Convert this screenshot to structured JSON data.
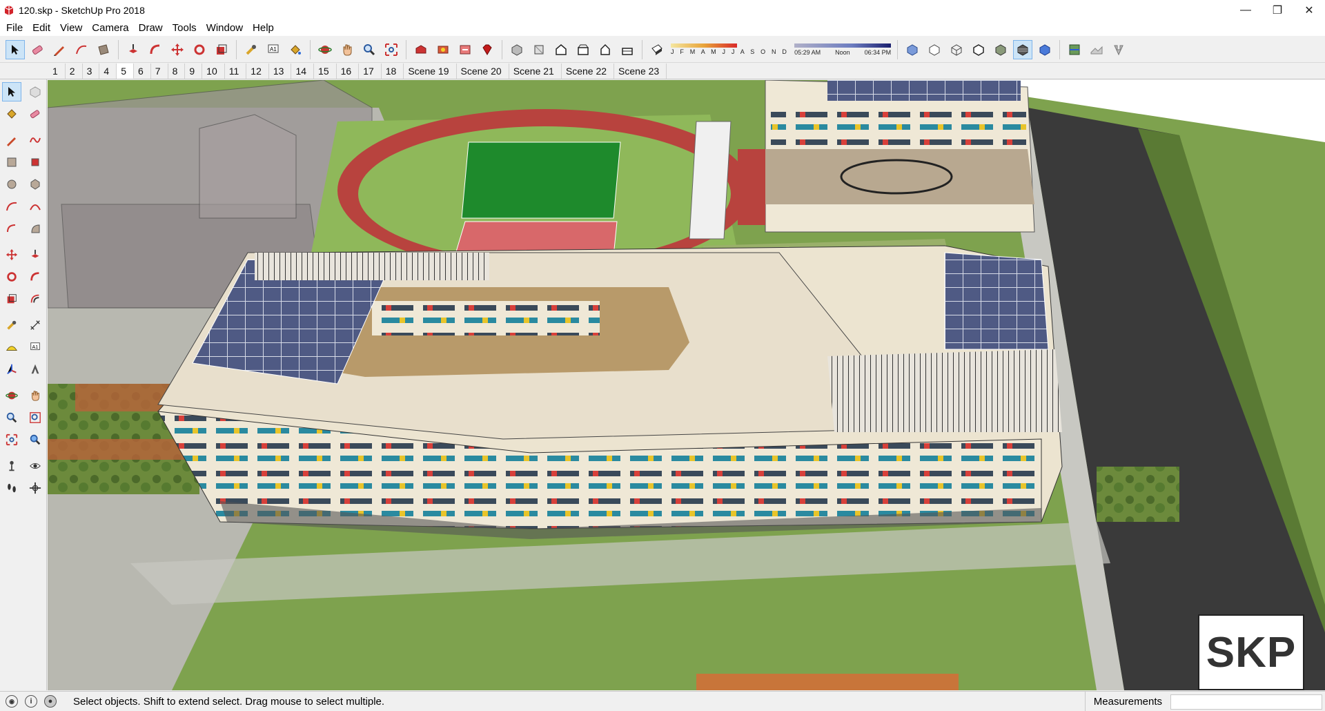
{
  "window": {
    "title": "120.skp - SketchUp Pro 2018",
    "controls": {
      "minimize": "—",
      "maximize": "❐",
      "close": "✕"
    }
  },
  "menu": {
    "items": [
      "File",
      "Edit",
      "View",
      "Camera",
      "Draw",
      "Tools",
      "Window",
      "Help"
    ]
  },
  "toolbar": {
    "shadow_months": "J F M A M J J A S O N D",
    "time_start": "05:29 AM",
    "time_noon": "Noon",
    "time_end": "06:34 PM"
  },
  "scenes": {
    "active_index": 4,
    "tabs": [
      "1",
      "2",
      "3",
      "4",
      "5",
      "6",
      "7",
      "8",
      "9",
      "10",
      "11",
      "12",
      "13",
      "14",
      "15",
      "16",
      "17",
      "18",
      "Scene 19",
      "Scene 20",
      "Scene 21",
      "Scene 22",
      "Scene 23"
    ]
  },
  "status": {
    "message": "Select objects. Shift to extend select. Drag mouse to select multiple.",
    "measurements_label": "Measurements",
    "measurements_value": ""
  },
  "viewport": {
    "logo_text": "SKP"
  },
  "colors": {
    "accent_select": "#cce4f7",
    "grass": "#7ea24e",
    "road": "#3a3a3a",
    "track": "#b8433e",
    "field": "#1e8a2c",
    "building": "#efe8d6",
    "glass": "#8a8e9e",
    "solar": "#4f5a84"
  }
}
